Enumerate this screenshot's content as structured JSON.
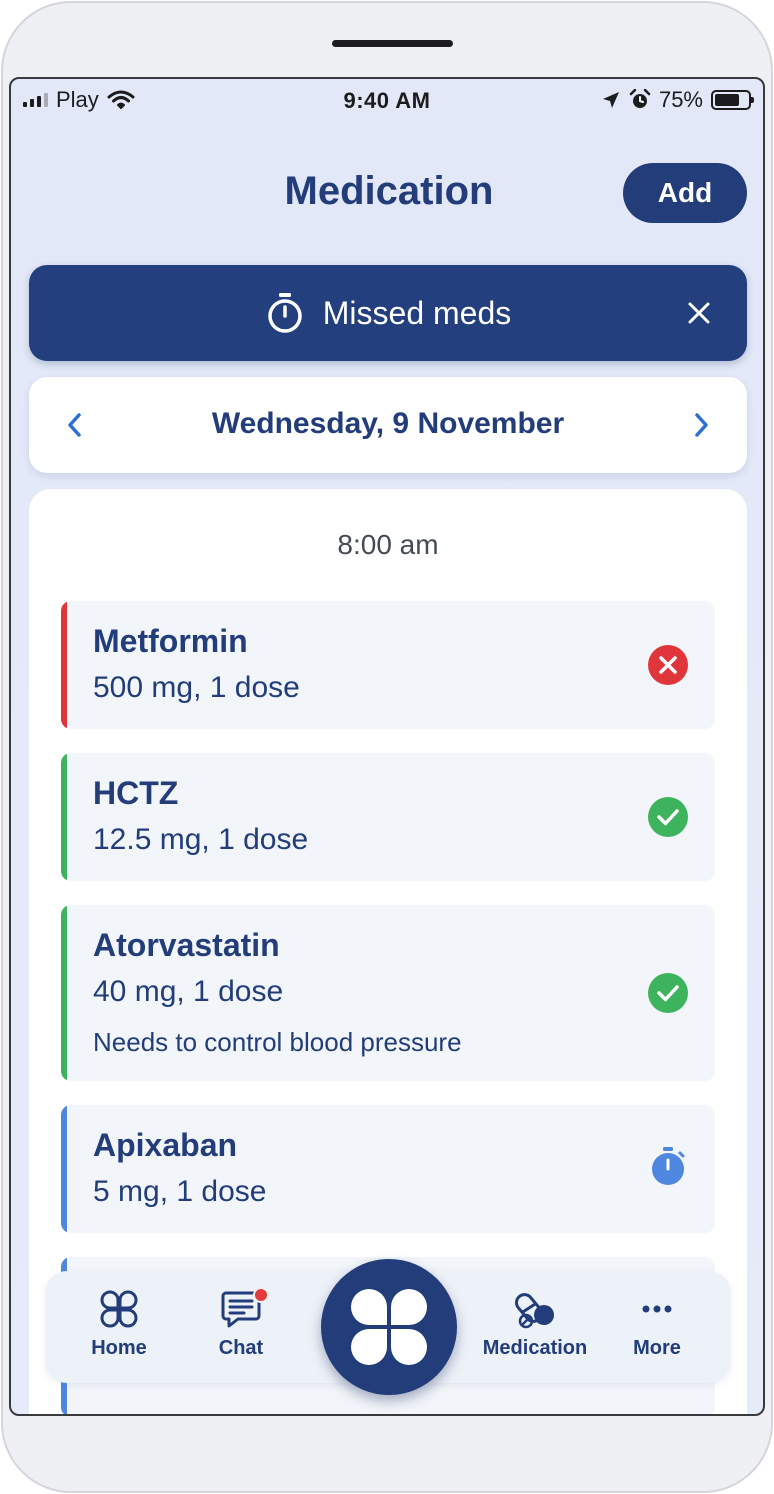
{
  "status_bar": {
    "carrier": "Play",
    "time": "9:40 AM",
    "battery": "75%",
    "battery_level": 0.75
  },
  "header": {
    "title": "Medication",
    "add_label": "Add"
  },
  "missed_banner": {
    "text": "Missed meds",
    "icon": "stopwatch-icon",
    "close_icon": "close-icon"
  },
  "date_nav": {
    "label": "Wednesday, 9 November",
    "prev_icon": "chevron-left-icon",
    "next_icon": "chevron-right-icon"
  },
  "schedule": {
    "time": "8:00 am",
    "items": [
      {
        "name": "Metformin",
        "dose": "500 mg, 1 dose",
        "note": "",
        "status": "missed",
        "color": "#e0353b"
      },
      {
        "name": "HCTZ",
        "dose": "12.5 mg, 1 dose",
        "note": "",
        "status": "taken",
        "color": "#3db35e"
      },
      {
        "name": "Atorvastatin",
        "dose": "40 mg, 1 dose",
        "note": "Needs to control blood pressure",
        "status": "taken",
        "color": "#3db35e"
      },
      {
        "name": "Apixaban",
        "dose": "5 mg, 1 dose",
        "note": "",
        "status": "pending",
        "color": "#4f86e0"
      }
    ]
  },
  "bottom_nav": {
    "items": [
      {
        "label": "Home",
        "icon": "home-clover-icon"
      },
      {
        "label": "Chat",
        "icon": "chat-icon",
        "badge": true
      },
      {
        "label": "Medication",
        "icon": "pill-icon"
      },
      {
        "label": "More",
        "icon": "more-icon"
      }
    ],
    "center_icon": "clover-icon"
  },
  "colors": {
    "primary": "#223d7a",
    "missed": "#e0353b",
    "taken": "#3db35e",
    "pending": "#4f86e0",
    "background": "#e3e9f8"
  }
}
